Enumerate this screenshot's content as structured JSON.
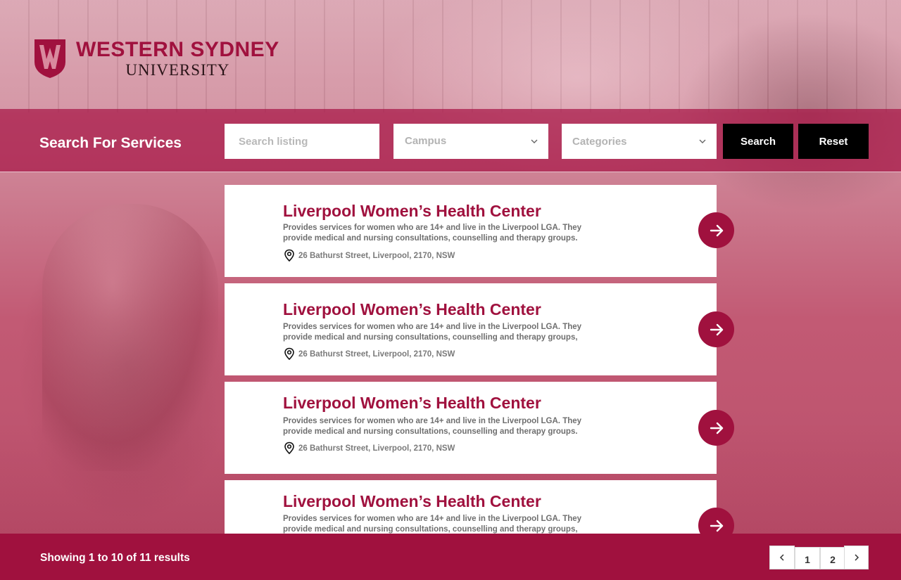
{
  "brand": {
    "name_line1": "WESTERN SYDNEY",
    "name_line2": "UNIVERSITY",
    "shield_letter": "W",
    "primary_color": "#a0113e"
  },
  "search": {
    "title": "Search For Services",
    "listing_placeholder": "Search listing",
    "campus_label": "Campus",
    "categories_label": "Categories",
    "search_button": "Search",
    "reset_button": "Reset"
  },
  "listings": [
    {
      "title": "Liverpool Women’s Health Center",
      "description": "Provides services for women who are 14+ and live in the Liverpool LGA. They provide medical and nursing consultations, counselling and therapy groups.",
      "address": "26 Bathurst Street, Liverpool, 2170, NSW"
    },
    {
      "title": "Liverpool Women’s Health Center",
      "description": "Provides services for women who are 14+ and live in the Liverpool LGA. They provide medical and nursing consultations, counselling and therapy groups,",
      "address": "26 Bathurst Street, Liverpool, 2170, NSW"
    },
    {
      "title": "Liverpool Women’s Health Center",
      "description": "Provides services for women who are 14+ and live in the Liverpool LGA. They provide medical and nursing consultations, counselling and therapy groups.",
      "address": "26 Bathurst Street, Liverpool, 2170, NSW"
    },
    {
      "title": "Liverpool Women’s Health Center",
      "description": "Provides services for women who are 14+ and live in the Liverpool LGA. They provide medical and nursing consultations, counselling and therapy groups,",
      "address": ""
    }
  ],
  "footer": {
    "results_text": "Showing 1 to 10 of 11 results",
    "pages": [
      "1",
      "2"
    ]
  }
}
